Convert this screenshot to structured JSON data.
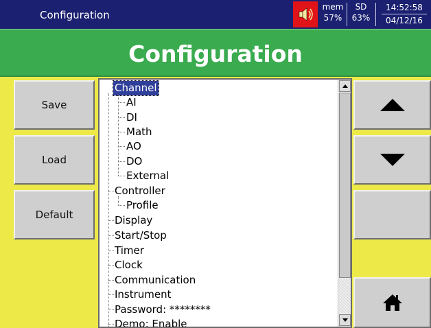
{
  "status_bar": {
    "title": "Configuration",
    "speaker_icon": "speaker-icon",
    "mem_label": "mem",
    "mem_value": "57%",
    "sd_label": "SD",
    "sd_value": "63%",
    "time": "14:52:58",
    "date": "04/12/16"
  },
  "header": {
    "title": "Configuration"
  },
  "left_buttons": {
    "save": "Save",
    "load": "Load",
    "default": "Default"
  },
  "right_buttons": {
    "up_icon": "arrow-up-icon",
    "down_icon": "arrow-down-icon",
    "home_icon": "home-icon"
  },
  "tree": {
    "items": [
      "Channel",
      "AI",
      "DI",
      "Math",
      "AO",
      "DO",
      "External",
      "Controller",
      "Profile",
      "Display",
      "Start/Stop",
      "Timer",
      "Clock",
      "Communication",
      "Instrument",
      "Password: ********",
      "Demo: Enable"
    ],
    "selected_index": 0
  },
  "colors": {
    "status_bar": "#1b2170",
    "header_green": "#3aab4f",
    "body_yellow": "#ece948",
    "selection": "#2f3f9a",
    "speaker_red": "#e01418"
  }
}
